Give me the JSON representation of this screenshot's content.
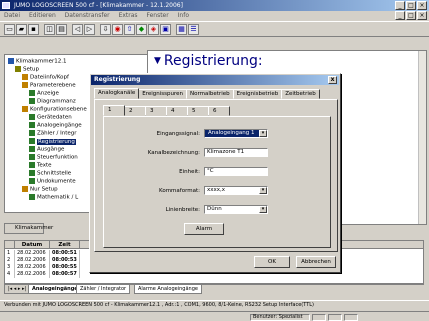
{
  "app": {
    "title": "JUMO LOGOSCREEN 500 cf - [Klimakammer - 12.1.2006]",
    "menu": [
      "Datei",
      "Editieren",
      "Datenstransfer",
      "Extras",
      "Fenster",
      "Info"
    ]
  },
  "tree": {
    "items": [
      {
        "label": "Klimakammer12.1",
        "level": 0
      },
      {
        "label": "Setup",
        "level": 1
      },
      {
        "label": "Dateiinfo/Kopf",
        "level": 2
      },
      {
        "label": "Parameterebene",
        "level": 2
      },
      {
        "label": "Anzeige",
        "level": 3
      },
      {
        "label": "Diagrammanz",
        "level": 3
      },
      {
        "label": "Konfigurationsebene",
        "level": 2
      },
      {
        "label": "Gerätedaten",
        "level": 3
      },
      {
        "label": "Analogeingänge",
        "level": 3
      },
      {
        "label": "Zähler / Integr",
        "level": 3
      },
      {
        "label": "Registrierung",
        "level": 3,
        "selected": true
      },
      {
        "label": "Ausgänge",
        "level": 3
      },
      {
        "label": "Steuerfunktion",
        "level": 3
      },
      {
        "label": "Texte",
        "level": 3
      },
      {
        "label": "Schnittstelle",
        "level": 3
      },
      {
        "label": "Undokumente",
        "level": 3
      },
      {
        "label": "Nur Setup",
        "level": 2
      },
      {
        "label": "Mathematik / L",
        "level": 3
      }
    ]
  },
  "main": {
    "heading": "Registrierung:",
    "bottom_tab": "Klimakammer"
  },
  "grid": {
    "headers": [
      "",
      "Datum",
      "Zeit"
    ],
    "rows": [
      {
        "n": "1",
        "date": "28.02.2006",
        "time": "08:00:51"
      },
      {
        "n": "2",
        "date": "28.02.2006",
        "time": "08:00:53"
      },
      {
        "n": "3",
        "date": "28.02.2006",
        "time": "08:00:55"
      },
      {
        "n": "4",
        "date": "28.02.2006",
        "time": "08:00:57"
      }
    ],
    "sheet_tabs": [
      "Analogeingänge",
      "Zähler / Integrator",
      "Alarme Analogeingänge"
    ]
  },
  "status": {
    "text": "Verbunden mit JUMO LOGOSCREEN 500 cf - Klimakammer12.1 , Adr.:1 , COM1, 9600, 8/1-Keine, RS232 Setup Interface(TTL)",
    "mode": "Benutzer: Spezialist"
  },
  "dialog": {
    "title": "Registrierung",
    "close": "x",
    "tabs": [
      "Analogkanäle",
      "Ereignisspuren",
      "Normalbetrieb",
      "Ereignisbetrieb",
      "Zeitbetrieb"
    ],
    "channel_tabs": [
      "1",
      "2",
      "3",
      "4",
      "5",
      "6"
    ],
    "fields": {
      "eingangssignal_label": "Eingangssignal:",
      "eingangssignal_value": "Analogeingang 1",
      "kanalbezeichnung_label": "Kanalbezeichnung:",
      "kanalbezeichnung_value": "Klimazone T1",
      "einheit_label": "Einheit:",
      "einheit_value": "°C",
      "kommaformat_label": "Kommaformat:",
      "kommaformat_value": "xxxx,x",
      "linienbreite_label": "Linienbreite:",
      "linienbreite_value": "Dünn"
    },
    "alarm_button": "Alarm",
    "ok_button": "OK",
    "cancel_button": "Abbrechen"
  }
}
